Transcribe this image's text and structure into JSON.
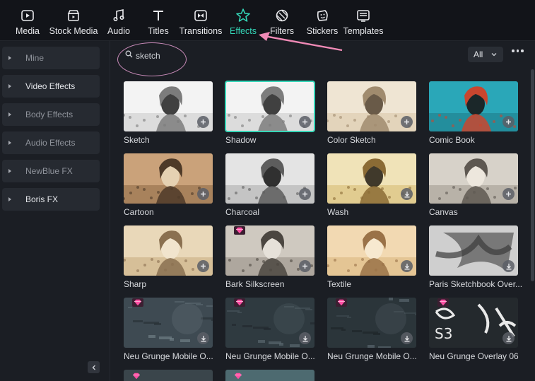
{
  "toolbar": {
    "items": [
      {
        "label": "Media",
        "icon": "media-icon"
      },
      {
        "label": "Stock Media",
        "icon": "stock-media-icon"
      },
      {
        "label": "Audio",
        "icon": "audio-note-icon"
      },
      {
        "label": "Titles",
        "icon": "titles-t-icon"
      },
      {
        "label": "Transitions",
        "icon": "transitions-icon"
      },
      {
        "label": "Effects",
        "icon": "effects-star-icon",
        "active": true
      },
      {
        "label": "Filters",
        "icon": "filters-icon"
      },
      {
        "label": "Stickers",
        "icon": "stickers-icon"
      },
      {
        "label": "Templates",
        "icon": "templates-icon"
      }
    ],
    "active_color": "#34d7b8"
  },
  "sidebar": {
    "items": [
      {
        "label": "Mine"
      },
      {
        "label": "Video Effects"
      },
      {
        "label": "Body Effects"
      },
      {
        "label": "Audio Effects"
      },
      {
        "label": "NewBlue FX"
      },
      {
        "label": "Boris FX"
      }
    ]
  },
  "search": {
    "value": "sketch",
    "placeholder": ""
  },
  "filter": {
    "selected": "All"
  },
  "effects": [
    {
      "name": "Sketch",
      "theme": "pencil",
      "action": "add"
    },
    {
      "name": "Shadow",
      "theme": "pencil",
      "action": "add",
      "selected": true
    },
    {
      "name": "Color Sketch",
      "theme": "color",
      "action": "add"
    },
    {
      "name": "Comic Book",
      "theme": "comic",
      "action": "add"
    },
    {
      "name": "Cartoon",
      "theme": "warm",
      "action": "add"
    },
    {
      "name": "Charcoal",
      "theme": "charcoal",
      "action": "add"
    },
    {
      "name": "Wash",
      "theme": "wash",
      "action": "download"
    },
    {
      "name": "Canvas",
      "theme": "canvas",
      "action": "add"
    },
    {
      "name": "Sharp",
      "theme": "warm2",
      "action": "add"
    },
    {
      "name": "Bark Silkscreen",
      "theme": "bark",
      "action": "add",
      "premium": true
    },
    {
      "name": "Textile",
      "theme": "textile",
      "action": "download"
    },
    {
      "name": "Paris Sketchbook Over...",
      "theme": "paris",
      "action": "download"
    },
    {
      "name": "Neu Grunge Mobile O...",
      "theme": "grunge",
      "action": "download",
      "premium": true
    },
    {
      "name": "Neu Grunge Mobile O...",
      "theme": "grunge2",
      "action": "download",
      "premium": true
    },
    {
      "name": "Neu Grunge Mobile O...",
      "theme": "grunge3",
      "action": "download",
      "premium": true
    },
    {
      "name": "Neu Grunge Overlay 06",
      "theme": "overlay",
      "action": "download",
      "premium": true
    }
  ]
}
